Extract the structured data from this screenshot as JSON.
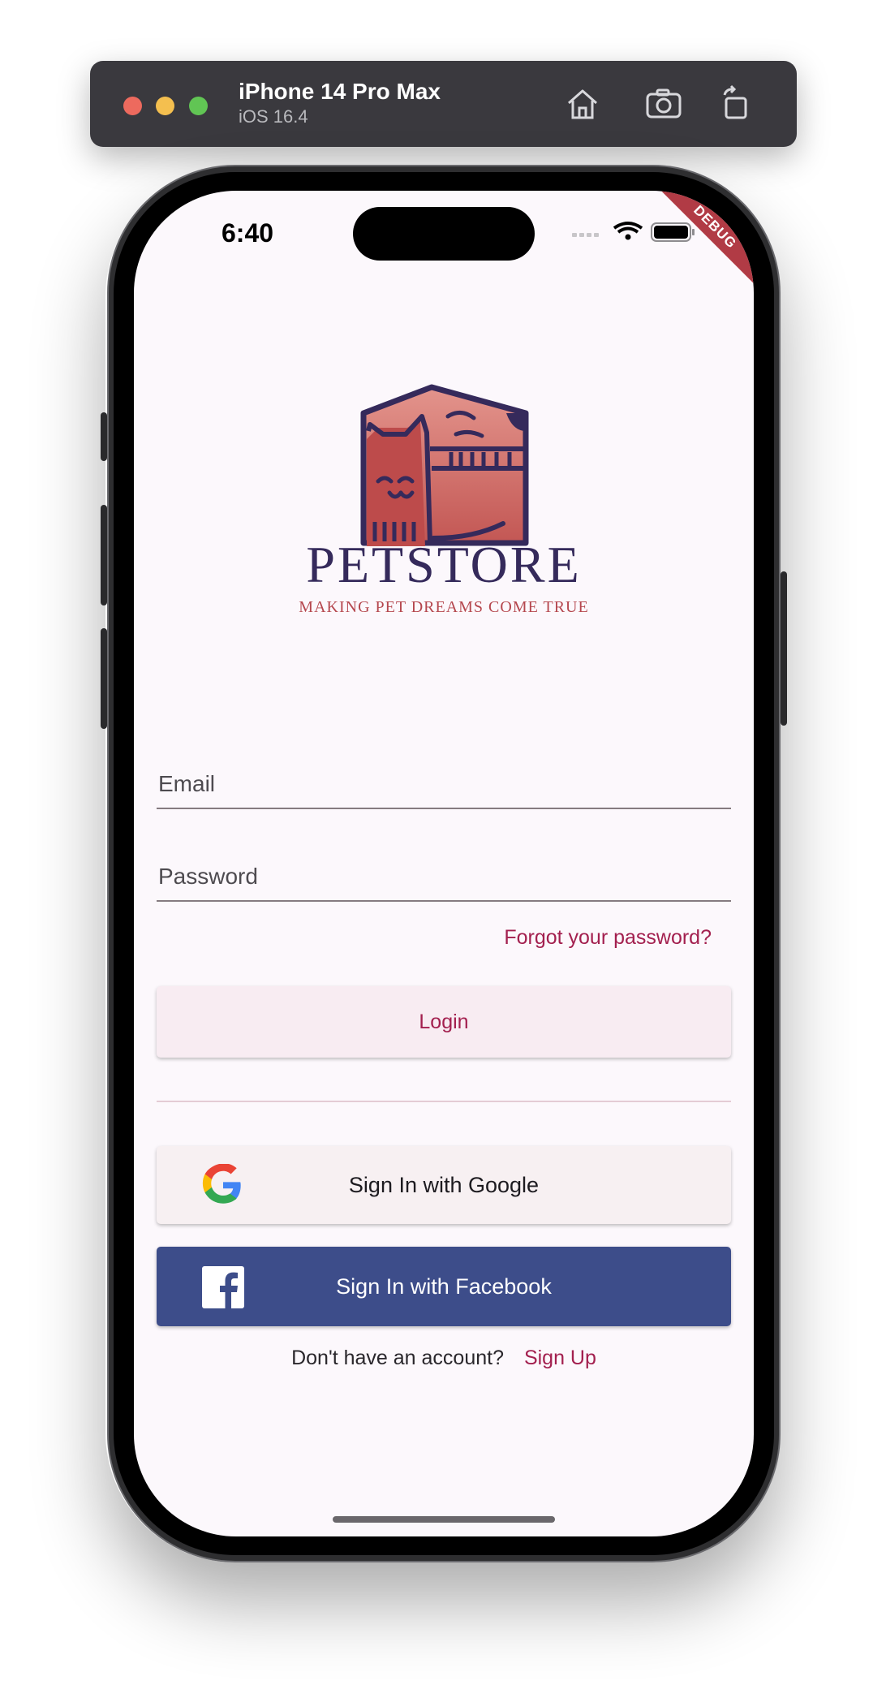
{
  "simulator": {
    "device_name": "iPhone 14 Pro Max",
    "os_version": "iOS 16.4",
    "buttons": [
      "home-icon",
      "screenshot-icon",
      "rotate-icon"
    ]
  },
  "status_bar": {
    "time": "6:40",
    "debug_banner": "DEBUG"
  },
  "logo": {
    "title": "PETSTORE",
    "tagline": "MAKING PET DREAMS COME TRUE"
  },
  "form": {
    "email_placeholder": "Email",
    "password_placeholder": "Password",
    "forgot_label": "Forgot your password?",
    "login_label": "Login"
  },
  "social": {
    "google_label": "Sign In with Google",
    "facebook_label": "Sign In with Facebook"
  },
  "signup": {
    "prompt": "Don't have an account?",
    "link": "Sign Up"
  },
  "colors": {
    "accent": "#a3204f",
    "facebook": "#3d4d8a",
    "logo_navy": "#352a5b",
    "logo_red": "#b5474e",
    "background": "#fcf8fc"
  }
}
